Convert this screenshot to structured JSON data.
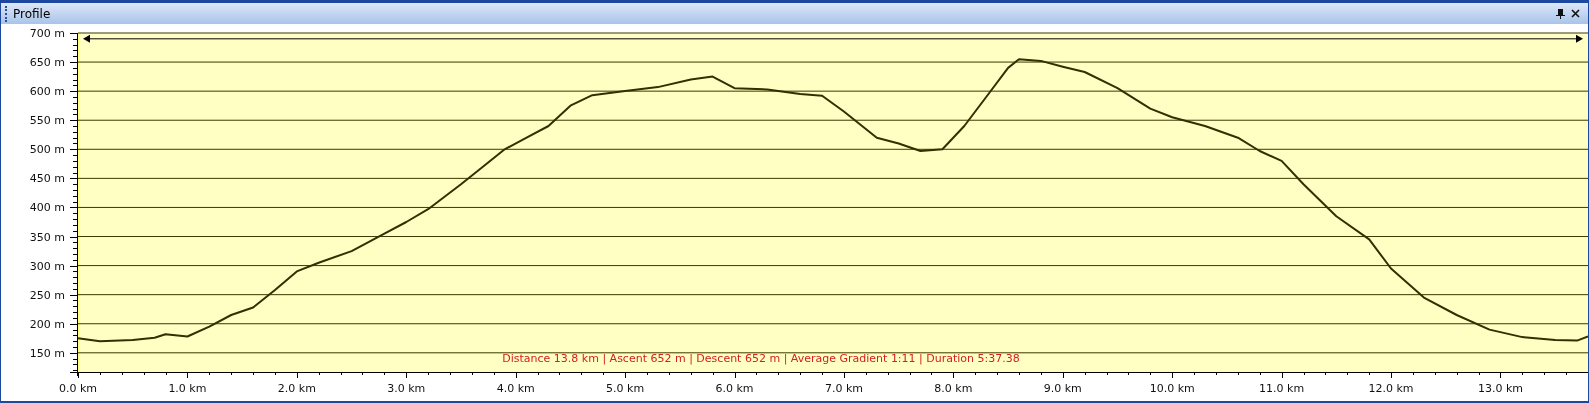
{
  "window": {
    "title": "Profile"
  },
  "profile": {
    "summary": "Distance 13.8 km | Ascent 652 m | Descent 652 m | Average Gradient 1:11 | Duration 5:37.38",
    "chart_data": {
      "type": "line",
      "xlim": [
        0,
        13.8
      ],
      "ylim": [
        117,
        700
      ],
      "x": [
        0,
        0.2,
        0.5,
        0.7,
        0.8,
        1.0,
        1.2,
        1.4,
        1.6,
        1.8,
        2.0,
        2.2,
        2.5,
        2.8,
        3.0,
        3.2,
        3.5,
        3.7,
        3.9,
        4.1,
        4.3,
        4.5,
        4.7,
        5.0,
        5.3,
        5.6,
        5.8,
        6.0,
        6.3,
        6.6,
        6.8,
        7.0,
        7.3,
        7.5,
        7.7,
        7.9,
        8.1,
        8.3,
        8.5,
        8.6,
        8.8,
        9.0,
        9.2,
        9.5,
        9.8,
        10.0,
        10.3,
        10.6,
        10.8,
        11.0,
        11.2,
        11.5,
        11.8,
        12.0,
        12.3,
        12.6,
        12.9,
        13.2,
        13.5,
        13.7,
        13.8
      ],
      "series": [
        {
          "color": "#332f00",
          "values": [
            175,
            170,
            172,
            176,
            182,
            178,
            195,
            215,
            228,
            258,
            290,
            305,
            325,
            355,
            375,
            397,
            440,
            470,
            500,
            520,
            540,
            575,
            593,
            600,
            607,
            620,
            625,
            605,
            603,
            595,
            592,
            565,
            520,
            510,
            497,
            500,
            540,
            590,
            640,
            655,
            652,
            642,
            633,
            605,
            570,
            555,
            540,
            520,
            497,
            480,
            440,
            385,
            345,
            295,
            245,
            215,
            190,
            177,
            172,
            171,
            178
          ]
        }
      ],
      "xticks": [
        {
          "value": 0,
          "label": "0.0 km"
        },
        {
          "value": 1,
          "label": "1.0 km"
        },
        {
          "value": 2,
          "label": "2.0 km"
        },
        {
          "value": 3,
          "label": "3.0 km"
        },
        {
          "value": 4,
          "label": "4.0 km"
        },
        {
          "value": 5,
          "label": "5.0 km"
        },
        {
          "value": 6,
          "label": "6.0 km"
        },
        {
          "value": 7,
          "label": "7.0 km"
        },
        {
          "value": 8,
          "label": "8.0 km"
        },
        {
          "value": 9,
          "label": "9.0 km"
        },
        {
          "value": 10,
          "label": "10.0 km"
        },
        {
          "value": 11,
          "label": "11.0 km"
        },
        {
          "value": 12,
          "label": "12.0 km"
        },
        {
          "value": 13,
          "label": "13.0 km"
        }
      ],
      "yticks": [
        {
          "value": 150,
          "label": "150 m"
        },
        {
          "value": 200,
          "label": "200 m"
        },
        {
          "value": 250,
          "label": "250 m"
        },
        {
          "value": 300,
          "label": "300 m"
        },
        {
          "value": 350,
          "label": "350 m"
        },
        {
          "value": 400,
          "label": "400 m"
        },
        {
          "value": 450,
          "label": "450 m"
        },
        {
          "value": 500,
          "label": "500 m"
        },
        {
          "value": 550,
          "label": "550 m"
        },
        {
          "value": 600,
          "label": "600 m"
        },
        {
          "value": 650,
          "label": "650 m"
        },
        {
          "value": 700,
          "label": "700 m"
        }
      ],
      "grid": true,
      "ref_lines": [
        {
          "axis": "y",
          "value": 690
        }
      ]
    }
  }
}
